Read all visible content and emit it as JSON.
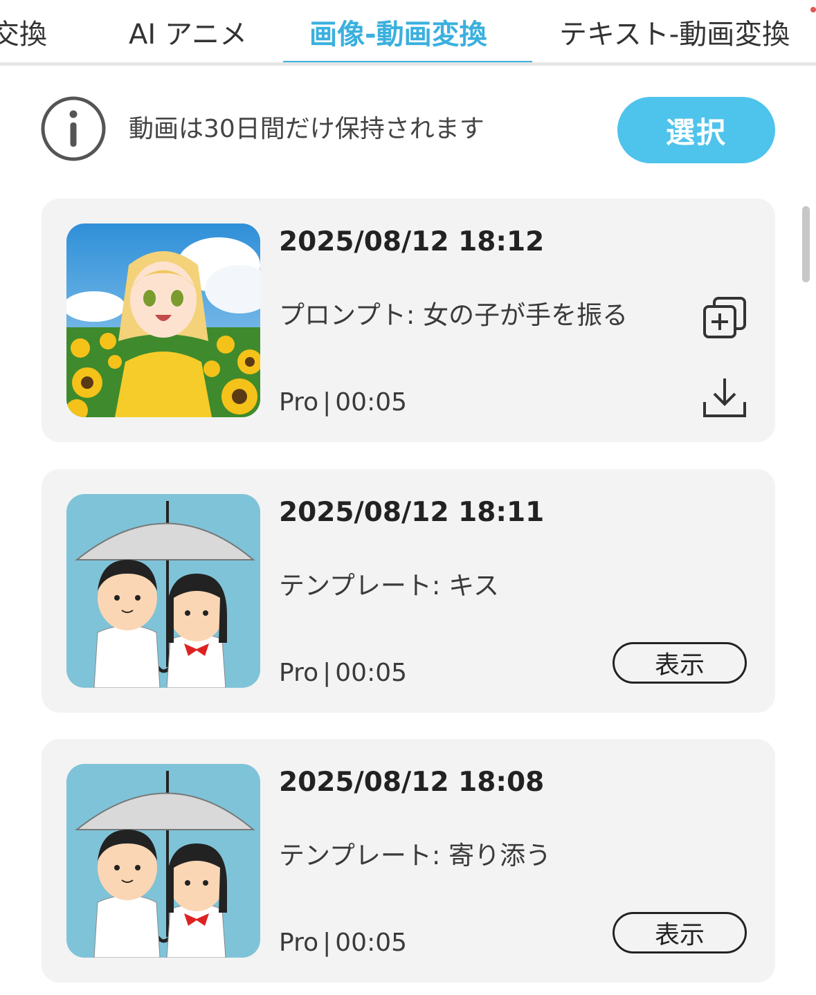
{
  "tabs": [
    {
      "label": "顔交換",
      "active": false
    },
    {
      "label": "AI アニメ",
      "active": false
    },
    {
      "label": "画像-動画変換",
      "active": true
    },
    {
      "label": "テキスト-動画変換",
      "active": false
    }
  ],
  "notice": {
    "icon": "info-icon",
    "text": "動画は30日間だけ保持されます"
  },
  "select_button": "選択",
  "items": [
    {
      "date": "2025/08/12 18:12",
      "prompt": "プロンプト: 女の子が手を振る",
      "plan": "Pro",
      "separator": "|",
      "duration": "00:05",
      "thumbnail": "anime-girl-sunflower-field",
      "actions": [
        "add-copy-icon",
        "download-icon"
      ]
    },
    {
      "date": "2025/08/12 18:11",
      "prompt": "テンプレート: キス",
      "plan": "Pro",
      "separator": "|",
      "duration": "00:05",
      "thumbnail": "couple-under-umbrella",
      "view_label": "表示"
    },
    {
      "date": "2025/08/12 18:08",
      "prompt": "テンプレート: 寄り添う",
      "plan": "Pro",
      "separator": "|",
      "duration": "00:05",
      "thumbnail": "couple-under-umbrella",
      "view_label": "表示"
    }
  ],
  "colors": {
    "accent": "#3ab0de",
    "button": "#4ec3ec",
    "card": "#f3f3f3"
  }
}
